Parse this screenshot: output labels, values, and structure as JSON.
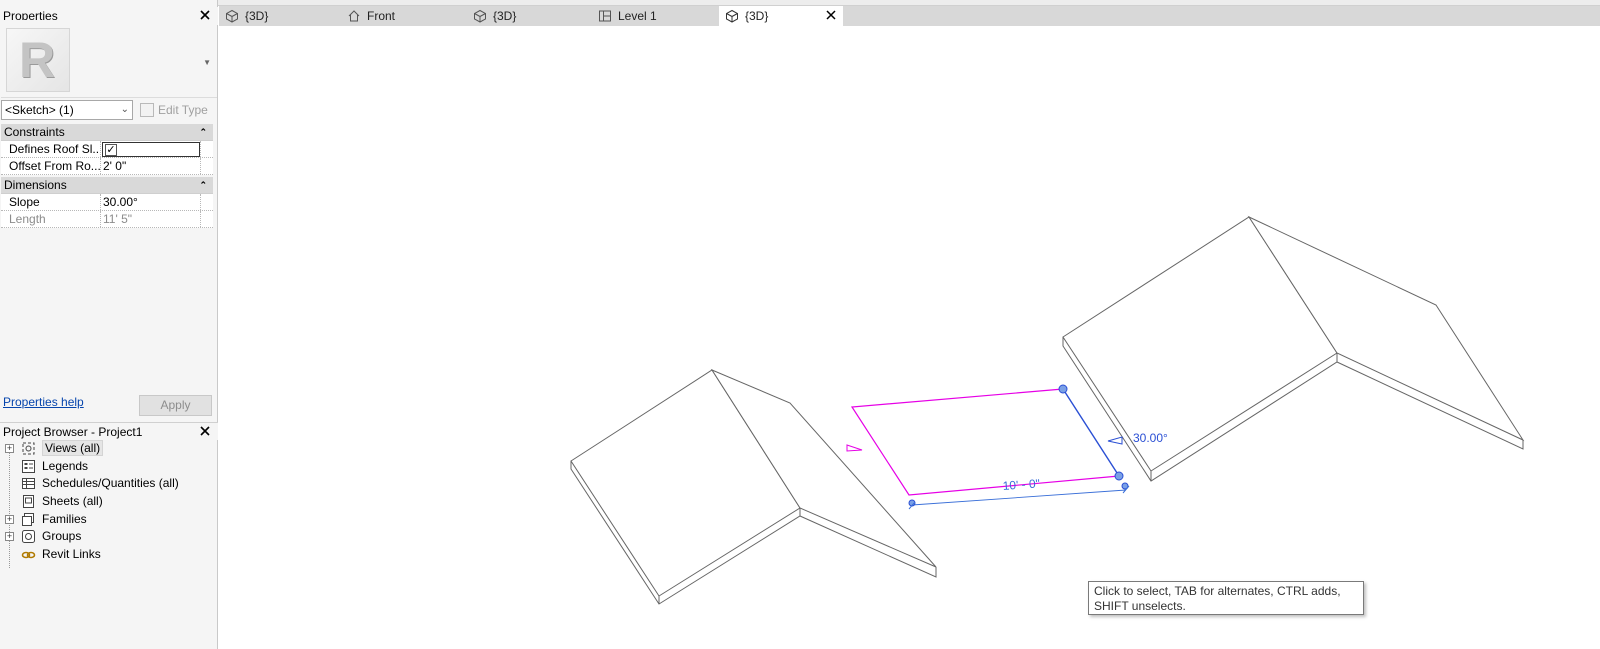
{
  "properties_panel": {
    "title": "Properties",
    "type_selector_logo": "R",
    "instance_selector": "<Sketch> (1)",
    "edit_type_label": "Edit Type",
    "groups": [
      {
        "name": "Constraints",
        "rows": [
          {
            "name": "Defines Roof Sl...",
            "value": "",
            "checked": true
          },
          {
            "name": "Offset From Ro...",
            "value": "2'  0\""
          }
        ]
      },
      {
        "name": "Dimensions",
        "rows": [
          {
            "name": "Slope",
            "value": "30.00°"
          },
          {
            "name": "Length",
            "value": "11'  5\"",
            "readonly": true
          }
        ]
      }
    ],
    "help_link": "Properties help",
    "apply_label": "Apply"
  },
  "project_browser": {
    "title": "Project Browser - Project1",
    "items": [
      {
        "label": "Views (all)",
        "expandable": true,
        "icon": "views-icon",
        "selected": true
      },
      {
        "label": "Legends",
        "expandable": false,
        "icon": "legend-icon"
      },
      {
        "label": "Schedules/Quantities (all)",
        "expandable": false,
        "icon": "schedule-icon"
      },
      {
        "label": "Sheets (all)",
        "expandable": false,
        "icon": "sheet-icon"
      },
      {
        "label": "Families",
        "expandable": true,
        "icon": "families-icon"
      },
      {
        "label": "Groups",
        "expandable": true,
        "icon": "groups-icon"
      },
      {
        "label": "Revit Links",
        "expandable": false,
        "icon": "revit-links-icon"
      }
    ]
  },
  "tabs": [
    {
      "label": "{3D}",
      "icon": "3d-view-icon"
    },
    {
      "label": "Front",
      "icon": "elevation-icon"
    },
    {
      "label": "{3D}",
      "icon": "3d-view-icon"
    },
    {
      "label": "Level 1",
      "icon": "floor-plan-icon"
    },
    {
      "label": "{3D}",
      "icon": "3d-view-icon",
      "active": true,
      "closable": true
    }
  ],
  "viewport": {
    "slope_annotation": "30.00°",
    "dimension_annotation": "10' - 0\"",
    "tooltip": "Click to select, TAB for alternates, CTRL adds, SHIFT unselects."
  },
  "colors": {
    "sketch_line": "#e600e6",
    "selected_line": "#2a4fd4",
    "dimension": "#3a6fd8",
    "panel_bg": "#f5f5f5",
    "tab_bar_bg": "#d8d8d8",
    "link": "#0645ad"
  }
}
